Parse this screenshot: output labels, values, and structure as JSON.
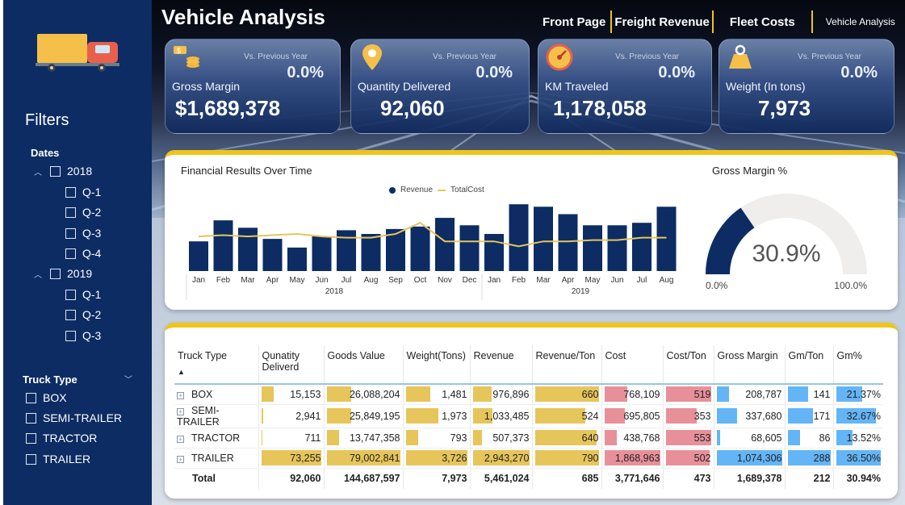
{
  "sidebar": {
    "filters_title": "Filters",
    "dates_label": "Dates",
    "years": [
      {
        "label": "2018",
        "quarters": [
          "Q-1",
          "Q-2",
          "Q-3",
          "Q-4"
        ]
      },
      {
        "label": "2019",
        "quarters": [
          "Q-1",
          "Q-2",
          "Q-3"
        ]
      }
    ],
    "truck_type_label": "Truck Type",
    "truck_types": [
      "BOX",
      "SEMI-TRAILER",
      "TRACTOR",
      "TRAILER"
    ]
  },
  "header": {
    "title": "Vehicle Analysis",
    "nav": [
      "Front Page",
      "Freight Revenue",
      "Fleet Costs",
      "Vehicle Analysis"
    ]
  },
  "kpis": [
    {
      "label": "Gross Margin",
      "value": "$1,689,378",
      "vs_label": "Vs. Previous Year",
      "vs_value": "0.0%",
      "icon": "coins-icon"
    },
    {
      "label": "Quantity Delivered",
      "value": "92,060",
      "vs_label": "Vs. Previous Year",
      "vs_value": "0.0%",
      "icon": "map-pin-icon"
    },
    {
      "label": "KM Traveled",
      "value": "1,178,058",
      "vs_label": "Vs. Previous Year",
      "vs_value": "0.0%",
      "icon": "speedometer-icon"
    },
    {
      "label": "Weight (In tons)",
      "value": "7,973",
      "vs_label": "Vs. Previous Year",
      "vs_value": "0.0%",
      "icon": "weight-icon"
    }
  ],
  "chart_data": [
    {
      "type": "bar",
      "title": "Financial Results Over Time",
      "categories": [
        "Jan",
        "Feb",
        "Mar",
        "Apr",
        "May",
        "Jun",
        "Jul",
        "Aug",
        "Sep",
        "Oct",
        "Nov",
        "Dec",
        "Jan",
        "Feb",
        "Mar",
        "Apr",
        "May",
        "Jun",
        "Jul",
        "Aug"
      ],
      "year_groups": [
        {
          "label": "2018",
          "count": 12
        },
        {
          "label": "2019",
          "count": 8
        }
      ],
      "series": [
        {
          "name": "Revenue",
          "type": "bar",
          "values": [
            240,
            410,
            350,
            260,
            190,
            280,
            330,
            300,
            340,
            360,
            430,
            370,
            300,
            540,
            520,
            460,
            370,
            370,
            390,
            520
          ]
        },
        {
          "name": "TotalCost",
          "type": "line",
          "values": [
            280,
            290,
            280,
            290,
            300,
            280,
            270,
            270,
            300,
            390,
            240,
            240,
            240,
            200,
            240,
            240,
            250,
            250,
            270,
            270
          ]
        }
      ],
      "ylim": [
        0,
        600
      ],
      "colors": {
        "Revenue": "#0c2c63",
        "TotalCost": "#e6c55a"
      },
      "legend": "top-center"
    },
    {
      "type": "gauge",
      "title": "Gross Margin %",
      "value": 30.9,
      "value_label": "30.9%",
      "min_label": "0.0%",
      "max_label": "100.0%",
      "min": 0,
      "max": 100,
      "colors": {
        "fill": "#0c2c63",
        "track": "#efeeec"
      }
    }
  ],
  "table": {
    "columns": [
      "Truck Type",
      "Qunatity Deliverd",
      "Goods Value",
      "Weight(Tons)",
      "Revenue",
      "Revenue/Ton",
      "Cost",
      "Cost/Ton",
      "Gross Margin",
      "Gm/Ton",
      "Gm%"
    ],
    "sort_indicator": "▲",
    "bar_colors": [
      "#e6c55a",
      "#e6c55a",
      "#e6c55a",
      "#e6c55a",
      "#e6c55a",
      "#e8909a",
      "#e8909a",
      "#64b5f6",
      "#64b5f6",
      "#64b5f6"
    ],
    "bar_fractions": [
      [
        0.21,
        0.33,
        0.4,
        0.33,
        1.0,
        0.41,
        1.0,
        0.19,
        0.49,
        0.59
      ],
      [
        0.04,
        0.33,
        0.53,
        0.35,
        0.79,
        0.37,
        0.68,
        0.31,
        0.59,
        0.9
      ],
      [
        0.01,
        0.17,
        0.21,
        0.17,
        0.97,
        0.23,
        1.07,
        0.06,
        0.3,
        0.37
      ],
      [
        1.0,
        1.0,
        1.0,
        1.0,
        1.2,
        1.0,
        0.97,
        1.0,
        1.0,
        1.0
      ]
    ],
    "rows": [
      {
        "cells": [
          "BOX",
          "15,153",
          "26,088,204",
          "1,481",
          "976,896",
          "660",
          "768,109",
          "519",
          "208,787",
          "141",
          "21.37%"
        ]
      },
      {
        "cells": [
          "SEMI-TRAILER",
          "2,941",
          "25,849,195",
          "1,973",
          "1,033,485",
          "524",
          "695,805",
          "353",
          "337,680",
          "171",
          "32.67%"
        ]
      },
      {
        "cells": [
          "TRACTOR",
          "711",
          "13,747,358",
          "793",
          "507,373",
          "640",
          "438,768",
          "553",
          "68,605",
          "86",
          "13.52%"
        ]
      },
      {
        "cells": [
          "TRAILER",
          "73,255",
          "79,002,841",
          "3,726",
          "2,943,270",
          "790",
          "1,868,963",
          "502",
          "1,074,306",
          "288",
          "36.50%"
        ]
      }
    ],
    "total": [
      "Total",
      "92,060",
      "144,687,597",
      "7,973",
      "5,461,024",
      "685",
      "3,771,646",
      "473",
      "1,689,378",
      "212",
      "30.94%"
    ]
  }
}
